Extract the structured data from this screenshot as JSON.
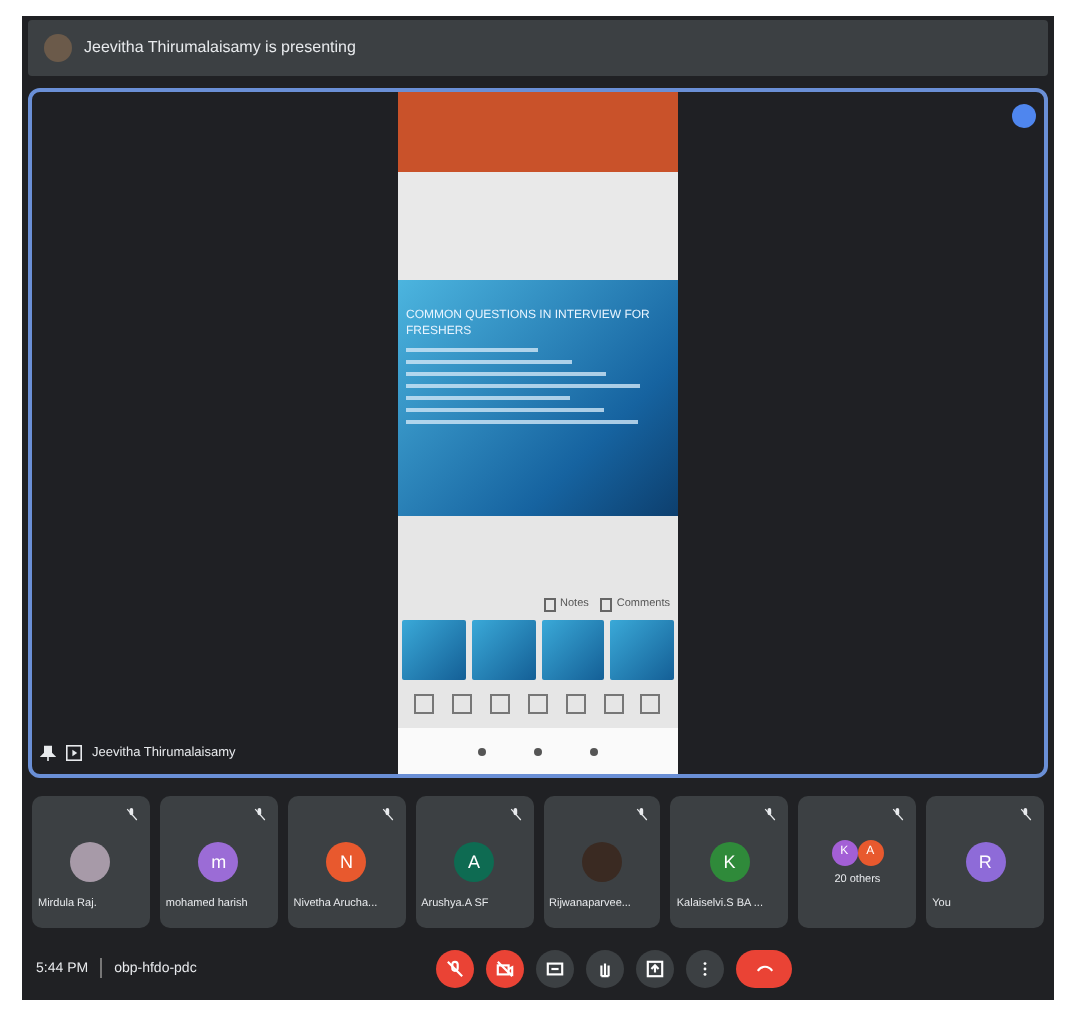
{
  "header": {
    "title": "Jeevitha Thirumalaisamy is presenting"
  },
  "stage": {
    "slide_title": "COMMON QUESTIONS IN INTERVIEW FOR FRESHERS",
    "notes_label": "Notes",
    "comments_label": "Comments",
    "presenter_name": "Jeevitha Thirumalaisamy"
  },
  "participants": [
    {
      "name": "Mirdula Raj.",
      "kind": "photo"
    },
    {
      "name": "mohamed harish",
      "kind": "letter",
      "initial": "m",
      "color": "#9b6cd6"
    },
    {
      "name": "Nivetha Arucha...",
      "kind": "letter",
      "initial": "N",
      "color": "#e8592e"
    },
    {
      "name": "Arushya.A SF",
      "kind": "letter",
      "initial": "A",
      "color": "#0e6b52"
    },
    {
      "name": "Rijwanaparvee...",
      "kind": "photo"
    },
    {
      "name": "Kalaiselvi.S BA ...",
      "kind": "letter",
      "initial": "K",
      "color": "#2f8a3a"
    },
    {
      "name": "20 others",
      "kind": "group",
      "initials": [
        {
          "initial": "K",
          "color": "#a35fd6"
        },
        {
          "initial": "A",
          "color": "#e8592e"
        }
      ]
    },
    {
      "name": "You",
      "kind": "letter",
      "initial": "R",
      "color": "#8e6bd8"
    }
  ],
  "footer": {
    "time": "5:44 PM",
    "meeting_code": "obp-hfdo-pdc"
  },
  "controls": [
    {
      "kind": "mic",
      "on": false
    },
    {
      "kind": "camera",
      "on": false
    },
    {
      "kind": "captions",
      "on": false
    },
    {
      "kind": "hand",
      "on": false
    },
    {
      "kind": "present",
      "on": false
    },
    {
      "kind": "more",
      "on": false
    },
    {
      "kind": "end"
    }
  ]
}
